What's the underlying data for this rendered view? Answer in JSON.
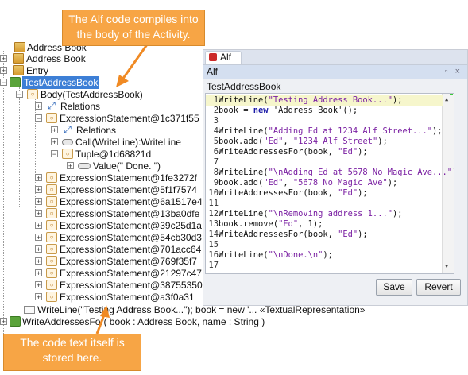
{
  "callouts": {
    "top": "The Alf code compiles into the body of the Activity.",
    "bottom": "The code text itself is stored here."
  },
  "tree": {
    "address_book_cut": "Address Book",
    "address_book": "Address Book",
    "entry": "Entry",
    "test_address_book": "TestAddressBook",
    "body": "Body(TestAddressBook)",
    "relations": "Relations",
    "expr_main": "ExpressionStatement@1c371f55",
    "relations_inner": "Relations",
    "call": "Call(WriteLine):WriteLine",
    "tuple": "Tuple@1d68821d",
    "value": "Value(\" Done. \")",
    "expressions": [
      "ExpressionStatement@1fe3272f",
      "ExpressionStatement@5f1f7574",
      "ExpressionStatement@6a1517e4",
      "ExpressionStatement@13ba0dfe",
      "ExpressionStatement@39c25d1a",
      "ExpressionStatement@54cb30d3",
      "ExpressionStatement@701acc64",
      "ExpressionStatement@769f35f7",
      "ExpressionStatement@21297c47",
      "ExpressionStatement@38755350",
      "ExpressionStatement@a3f0a31"
    ],
    "textual": "WriteLine(\"Testing Address Book...\"); book = new '... «TextualRepresentation»",
    "write_addresses": "WriteAddressesFor( book : Address Book, name : String )"
  },
  "editor": {
    "tab": "Alf",
    "title": "Alf",
    "window_controls": "▫ ×",
    "module": "TestAddressBook",
    "lines": [
      {
        "n": "1",
        "parts": [
          [
            "p",
            "WriteLine("
          ],
          [
            "s",
            "\"Testing Address Book...\""
          ],
          [
            "p",
            ");"
          ]
        ]
      },
      {
        "n": "2",
        "parts": [
          [
            "p",
            "book = "
          ],
          [
            "k",
            "new"
          ],
          [
            "p",
            " 'Address Book'();"
          ]
        ]
      },
      {
        "n": "3",
        "parts": []
      },
      {
        "n": "4",
        "parts": [
          [
            "p",
            "WriteLine("
          ],
          [
            "s",
            "\"Adding Ed at 1234 Alf Street...\""
          ],
          [
            "p",
            ");"
          ]
        ]
      },
      {
        "n": "5",
        "parts": [
          [
            "p",
            "book.add("
          ],
          [
            "s",
            "\"Ed\""
          ],
          [
            "p",
            ", "
          ],
          [
            "s",
            "\"1234 Alf Street\""
          ],
          [
            "p",
            ");"
          ]
        ]
      },
      {
        "n": "6",
        "parts": [
          [
            "p",
            "WriteAddressesFor(book, "
          ],
          [
            "s",
            "\"Ed\""
          ],
          [
            "p",
            ");"
          ]
        ]
      },
      {
        "n": "7",
        "parts": []
      },
      {
        "n": "8",
        "parts": [
          [
            "p",
            "WriteLine("
          ],
          [
            "s",
            "\"\\nAdding Ed at 5678 No Magic Ave...\""
          ],
          [
            "p",
            ");"
          ]
        ]
      },
      {
        "n": "9",
        "parts": [
          [
            "p",
            "book.add("
          ],
          [
            "s",
            "\"Ed\""
          ],
          [
            "p",
            ", "
          ],
          [
            "s",
            "\"5678 No Magic Ave\""
          ],
          [
            "p",
            ");"
          ]
        ]
      },
      {
        "n": "10",
        "parts": [
          [
            "p",
            "WriteAddressesFor(book, "
          ],
          [
            "s",
            "\"Ed\""
          ],
          [
            "p",
            ");"
          ]
        ]
      },
      {
        "n": "11",
        "parts": []
      },
      {
        "n": "12",
        "parts": [
          [
            "p",
            "WriteLine("
          ],
          [
            "s",
            "\"\\nRemoving address 1...\""
          ],
          [
            "p",
            ");"
          ]
        ]
      },
      {
        "n": "13",
        "parts": [
          [
            "p",
            "book.remove("
          ],
          [
            "s",
            "\"Ed\""
          ],
          [
            "p",
            ", 1);"
          ]
        ]
      },
      {
        "n": "14",
        "parts": [
          [
            "p",
            "WriteAddressesFor(book, "
          ],
          [
            "s",
            "\"Ed\""
          ],
          [
            "p",
            ");"
          ]
        ]
      },
      {
        "n": "15",
        "parts": []
      },
      {
        "n": "16",
        "parts": [
          [
            "p",
            "WriteLine("
          ],
          [
            "s",
            "\"\\nDone.\\n\""
          ],
          [
            "p",
            ");"
          ]
        ]
      },
      {
        "n": "17",
        "parts": []
      }
    ],
    "save_label": "Save",
    "revert_label": "Revert"
  },
  "colors": {
    "callout": "#f7a545",
    "selection": "#3d7fd6",
    "string": "#7a1fa2",
    "keyword": "#1a1aa6"
  }
}
